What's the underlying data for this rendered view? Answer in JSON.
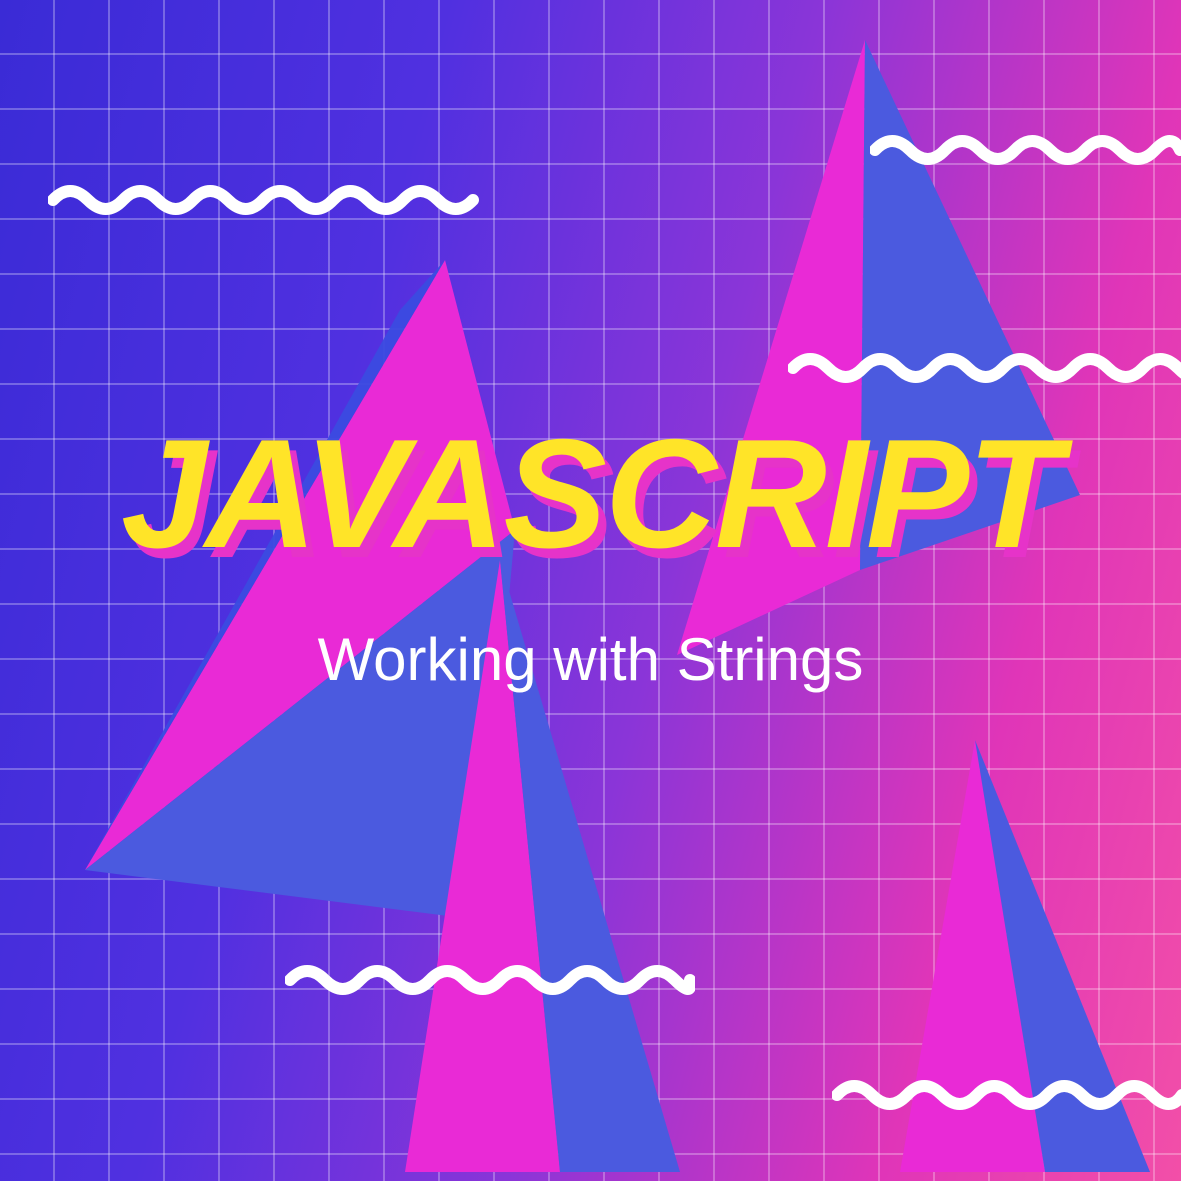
{
  "graphic": {
    "title": "JAVASCRIPT",
    "subtitle": "Working with Strings"
  },
  "colors": {
    "titleFill": "#ffe428",
    "titleShadow": "#e633c9",
    "subtitle": "#ffffff",
    "gradientStart": "#3a2bd6",
    "gradientEnd": "#f24fa8",
    "shapeMagenta": "#e92ad6",
    "shapeBlue": "#4b5adf",
    "squiggle": "#ffffff"
  }
}
